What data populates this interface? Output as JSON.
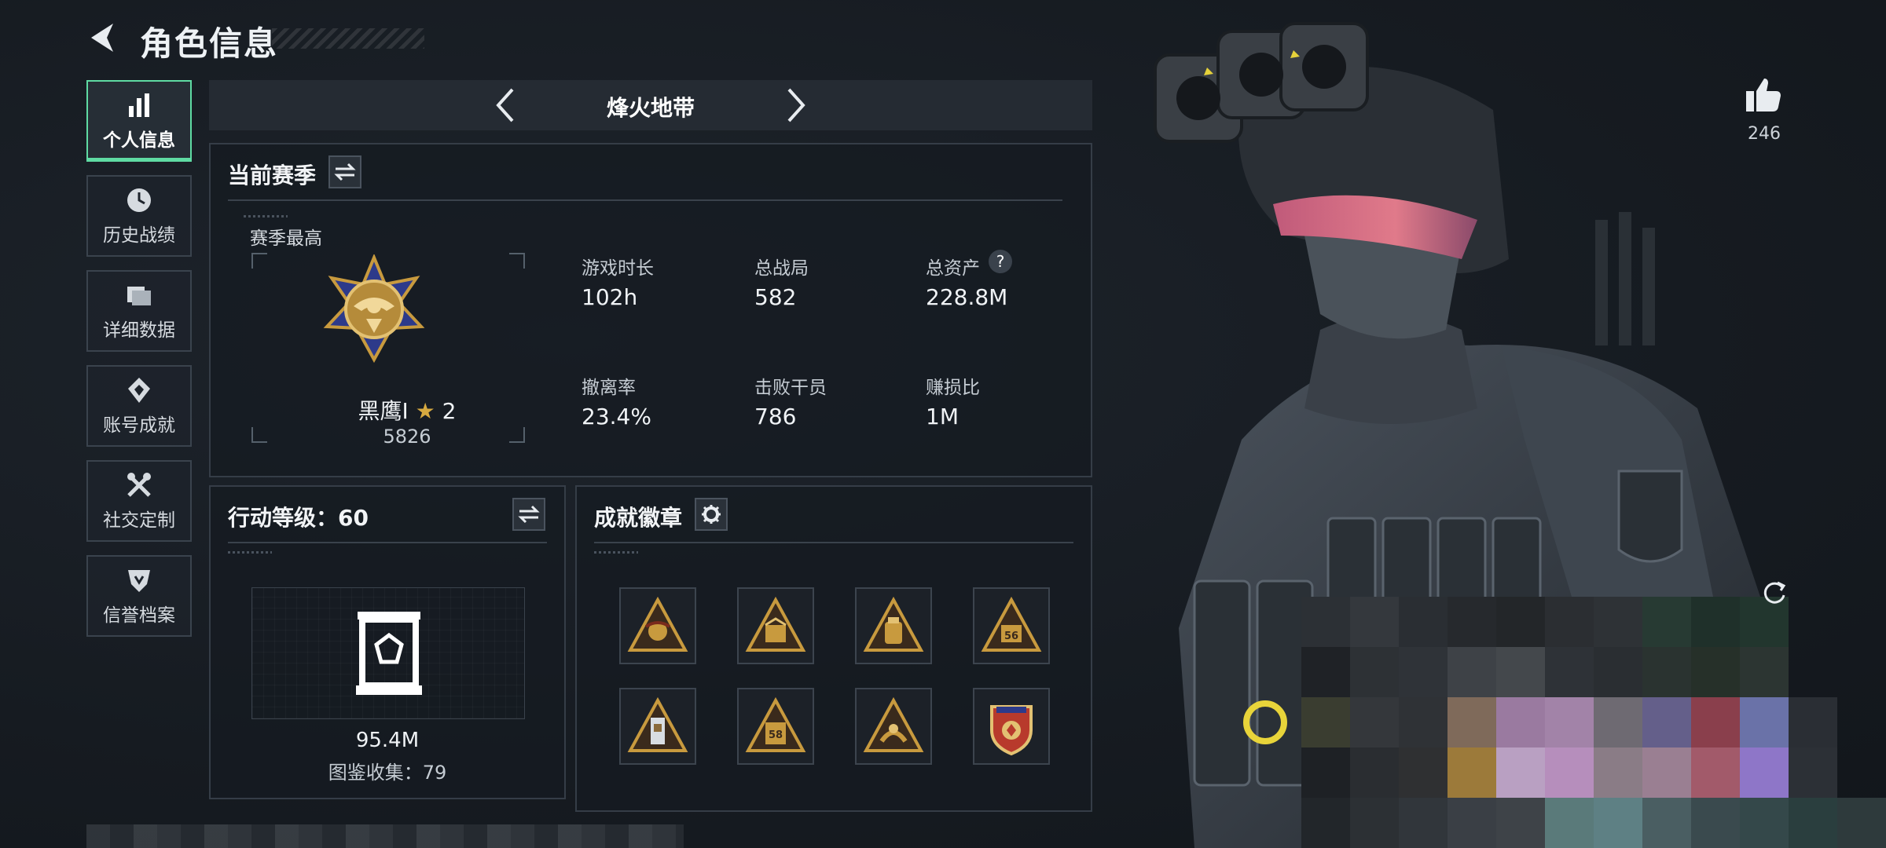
{
  "header": {
    "title": "角色信息"
  },
  "nav": {
    "items": [
      {
        "label": "个人信息",
        "icon": "bar-chart-icon",
        "active": true
      },
      {
        "label": "历史战绩",
        "icon": "clock-icon",
        "active": false
      },
      {
        "label": "详细数据",
        "icon": "folder-icon",
        "active": false
      },
      {
        "label": "账号成就",
        "icon": "achievement-icon",
        "active": false
      },
      {
        "label": "社交定制",
        "icon": "tools-icon",
        "active": false
      },
      {
        "label": "信誉档案",
        "icon": "shield-icon",
        "active": false
      }
    ]
  },
  "mode": {
    "label": "烽火地带"
  },
  "season": {
    "title": "当前赛季",
    "best_label": "赛季最高",
    "rank_name": "黑鹰Ⅰ",
    "rank_stars": "2",
    "rank_points": "5826",
    "stats": [
      {
        "label": "游戏时长",
        "value": "102h"
      },
      {
        "label": "总战局",
        "value": "582"
      },
      {
        "label": "总资产",
        "value": "228.8M"
      },
      {
        "label": "撤离率",
        "value": "23.4%"
      },
      {
        "label": "击败干员",
        "value": "786"
      },
      {
        "label": "赚损比",
        "value": "1M"
      }
    ],
    "help_symbol": "?"
  },
  "level": {
    "title": "行动等级：60",
    "value": "95.4M",
    "collection": "图鉴收集：79"
  },
  "badges": {
    "title": "成就徽章",
    "items": [
      {
        "icon": "badge-eagle-icon"
      },
      {
        "icon": "badge-crate-icon"
      },
      {
        "icon": "badge-bag-icon"
      },
      {
        "icon": "badge-56-icon"
      },
      {
        "icon": "badge-tower-icon"
      },
      {
        "icon": "badge-58-icon"
      },
      {
        "icon": "badge-hands-icon"
      },
      {
        "icon": "badge-shield-medal-icon"
      }
    ]
  },
  "likes": {
    "count": "246"
  },
  "colors": {
    "accent": "#5fdba3",
    "gold": "#c89a3e",
    "panel_border": "#353d47"
  }
}
